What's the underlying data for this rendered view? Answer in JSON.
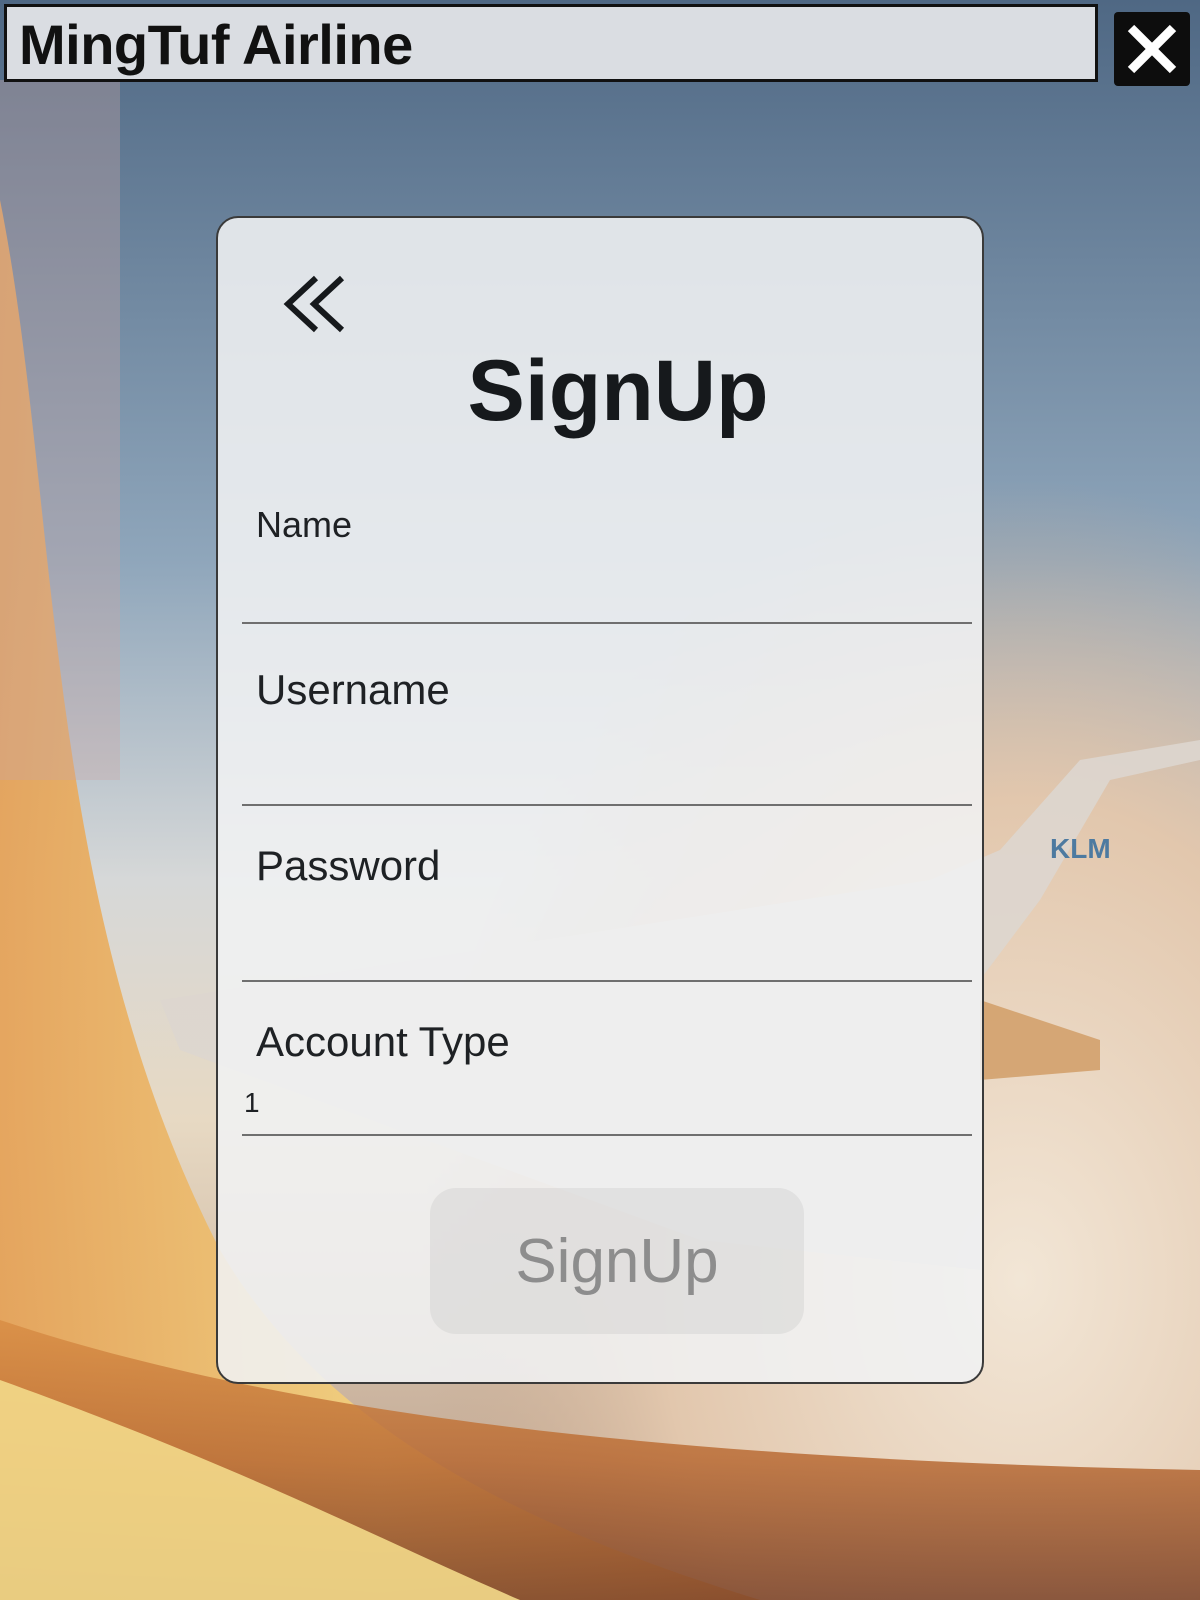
{
  "window": {
    "title": "MingTuf Airline",
    "close_icon": "close-icon"
  },
  "form": {
    "back_icon": "double-chevron-left-icon",
    "title": "SignUp",
    "fields": [
      {
        "label": "Name",
        "value": ""
      },
      {
        "label": "Username",
        "value": ""
      },
      {
        "label": "Password",
        "value": ""
      },
      {
        "label": "Account Type",
        "value": "1"
      }
    ],
    "submit_label": "SignUp"
  },
  "background": {
    "wing_logo": "KLM"
  },
  "colors": {
    "titlebar_bg": "#dadde2",
    "card_bg": "#f0f1f3",
    "button_text": "#8d8d8d"
  }
}
